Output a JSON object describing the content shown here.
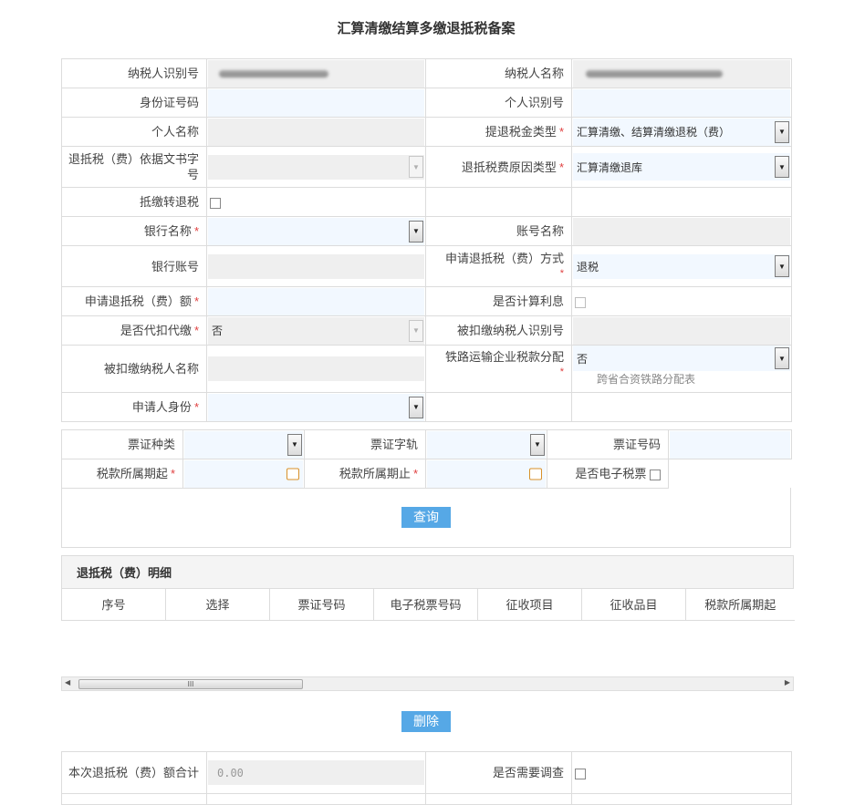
{
  "page": {
    "title": "汇算清缴结算多缴退抵税备案"
  },
  "form": {
    "taxpayer_id_label": "纳税人识别号",
    "taxpayer_name_label": "纳税人名称",
    "id_card_label": "身份证号码",
    "personal_id_label": "个人识别号",
    "personal_name_label": "个人名称",
    "refund_type_label": "提退税金类型",
    "refund_type_value": "汇算清缴、结算清缴退税（费）",
    "basis_doc_label": "退抵税（费）依据文书字号",
    "reason_type_label": "退抵税费原因类型",
    "reason_type_value": "汇算清缴退库",
    "offset_label": "抵缴转退税",
    "bank_name_label": "银行名称",
    "account_name_label": "账号名称",
    "bank_account_label": "银行账号",
    "apply_method_label": "申请退抵税（费）方式",
    "apply_method_value": "退税",
    "apply_amount_label": "申请退抵税（费）额",
    "calc_interest_label": "是否计算利息",
    "withhold_label": "是否代扣代缴",
    "withhold_value": "否",
    "withheld_id_label": "被扣缴纳税人识别号",
    "withheld_name_label": "被扣缴纳税人名称",
    "railway_label": "铁路运输企业税款分配",
    "railway_value": "否",
    "railway_hint": "跨省合资铁路分配表",
    "applicant_label": "申请人身份",
    "required_mark": "*"
  },
  "query": {
    "voucher_type_label": "票证种类",
    "voucher_track_label": "票证字轨",
    "voucher_no_label": "票证号码",
    "period_start_label": "税款所属期起",
    "period_end_label": "税款所属期止",
    "e_ticket_label": "是否电子税票",
    "query_button": "查询"
  },
  "detail": {
    "title": "退抵税（费）明细",
    "columns": [
      "序号",
      "选择",
      "票证号码",
      "电子税票号码",
      "征收项目",
      "征收品目",
      "税款所属期起"
    ],
    "scroll_grip": "III",
    "delete_button": "删除"
  },
  "summary": {
    "total_label": "本次退抵税（费）额合计",
    "total_value": "0.00",
    "need_survey_label": "是否需要调查"
  }
}
